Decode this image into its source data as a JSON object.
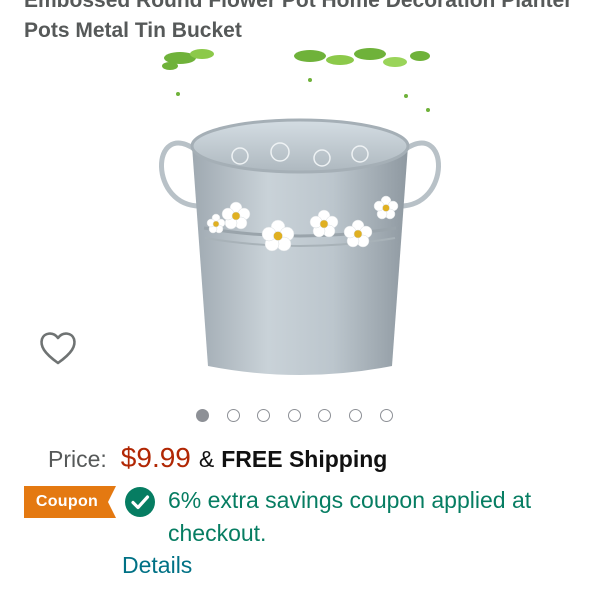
{
  "product": {
    "title_line1": "Embossed Round Flower Pot Home Decoration Planter",
    "title_line2": "Pots Metal Tin Bucket"
  },
  "gallery": {
    "image_count": 7,
    "active_index": 0
  },
  "icons": {
    "wishlist": "heart-outline-icon",
    "coupon_check": "check-circle-icon"
  },
  "pricing": {
    "label": "Price:",
    "price": "$9.99",
    "separator": "&",
    "shipping": "FREE Shipping"
  },
  "coupon": {
    "badge": "Coupon",
    "message": "6% extra savings coupon applied at checkout.",
    "details_link": "Details"
  },
  "colors": {
    "price": "#b12704",
    "coupon_badge": "#e47911",
    "coupon_text": "#067d62",
    "link": "#007185"
  }
}
